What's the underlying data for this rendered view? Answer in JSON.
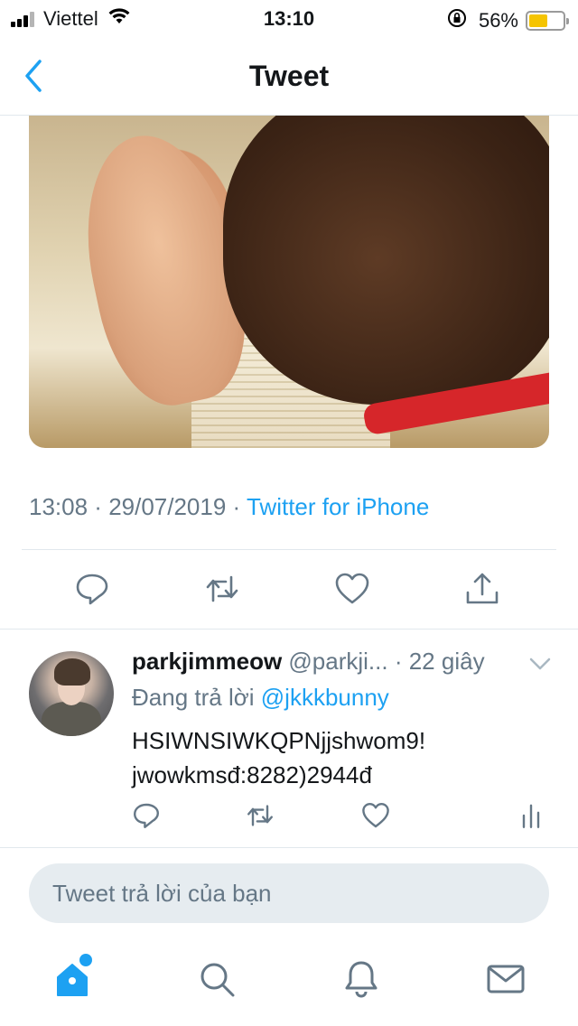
{
  "status_bar": {
    "carrier": "Viettel",
    "time": "13:10",
    "battery_percent": "56%",
    "battery_level": 0.56,
    "battery_color": "#f5c400",
    "icons": [
      "signal-icon",
      "wifi-icon",
      "orientation-lock-icon",
      "battery-icon"
    ]
  },
  "nav": {
    "title": "Tweet",
    "back_icon": "chevron-left-icon"
  },
  "tweet": {
    "time": "13:08",
    "separator": " · ",
    "date": "29/07/2019",
    "separator2": " · ",
    "source": "Twitter for iPhone",
    "actions": [
      "reply-icon",
      "retweet-icon",
      "like-icon",
      "share-icon"
    ]
  },
  "reply": {
    "name": "parkjimmeow",
    "handle": "@parkji...",
    "time": "· 22 giây",
    "replying_prefix": "Đang trả lời ",
    "replying_to": "@jkkkbunny",
    "text_line1": "HSIWNSIWKQPNjjshwom9!",
    "text_line2": "jwowkmsđ:8282)2944đ",
    "actions": [
      "reply-icon",
      "retweet-icon",
      "like-icon",
      "analytics-icon"
    ]
  },
  "compose": {
    "placeholder": "Tweet trả lời của bạn"
  },
  "tabs": [
    "home-icon",
    "search-icon",
    "notifications-icon",
    "messages-icon"
  ],
  "colors": {
    "accent": "#1da1f2",
    "muted": "#657786",
    "divider": "#e1e8ed"
  }
}
